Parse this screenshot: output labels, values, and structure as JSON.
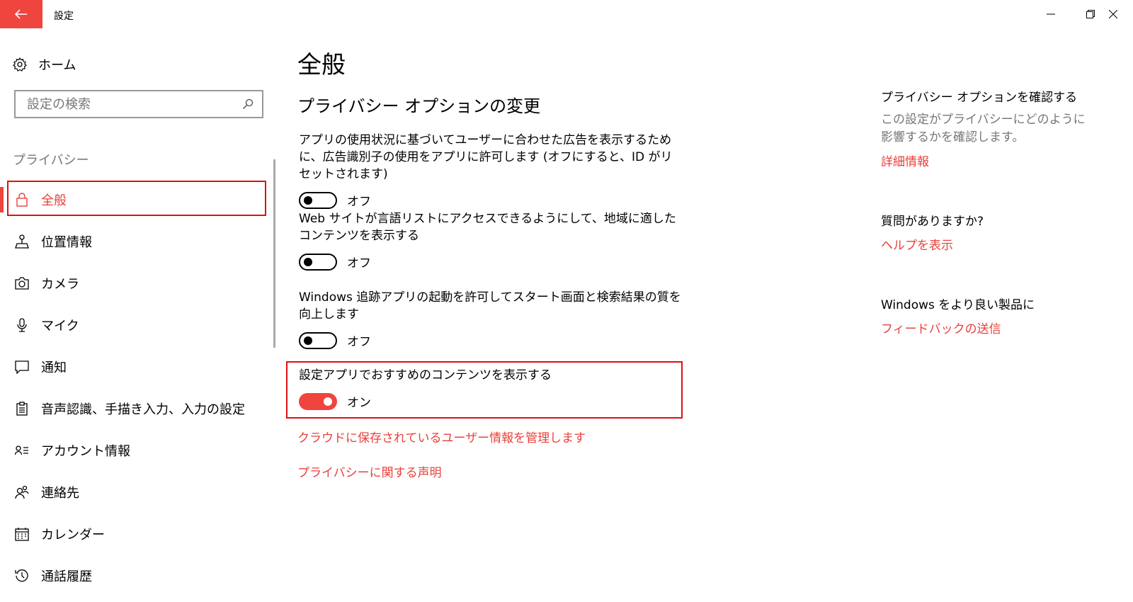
{
  "window": {
    "title": "設定",
    "accent_color": "#f0443e"
  },
  "sidebar": {
    "home_label": "ホーム",
    "search_placeholder": "設定の検索",
    "section_label": "プライバシー",
    "items": [
      {
        "label": "全般",
        "icon": "lock-icon",
        "active": true
      },
      {
        "label": "位置情報",
        "icon": "location-icon"
      },
      {
        "label": "カメラ",
        "icon": "camera-icon"
      },
      {
        "label": "マイク",
        "icon": "microphone-icon"
      },
      {
        "label": "通知",
        "icon": "notification-icon"
      },
      {
        "label": "音声認識、手描き入力、入力の設定",
        "icon": "clipboard-icon"
      },
      {
        "label": "アカウント情報",
        "icon": "account-info-icon"
      },
      {
        "label": "連絡先",
        "icon": "contacts-icon"
      },
      {
        "label": "カレンダー",
        "icon": "calendar-icon"
      },
      {
        "label": "通話履歴",
        "icon": "history-icon"
      }
    ]
  },
  "main": {
    "page_title": "全般",
    "section_title": "プライバシー オプションの変更",
    "settings": [
      {
        "desc": "アプリの使用状況に基づいてユーザーに合わせた広告を表示するために、広告識別子の使用をアプリに許可します (オフにすると、ID がリセットされます)",
        "state": "オフ"
      },
      {
        "desc": "Web サイトが言語リストにアクセスできるようにして、地域に適したコンテンツを表示する",
        "state": "オフ"
      },
      {
        "desc": "Windows 追跡アプリの起動を許可してスタート画面と検索結果の質を向上します",
        "state": "オフ"
      },
      {
        "desc": "設定アプリでおすすめのコンテンツを表示する",
        "state": "オン"
      }
    ],
    "links": {
      "cloud": "クラウドに保存されているユーザー情報を管理します",
      "privacy_statement": "プライバシーに関する声明"
    }
  },
  "right_panel": {
    "privacy_header": "プライバシー オプションを確認する",
    "privacy_desc": "この設定がプライバシーにどのように影響するかを確認します。",
    "privacy_link": "詳細情報",
    "question_header": "質問がありますか?",
    "help_link": "ヘルプを表示",
    "feedback_header": "Windows をより良い製品に",
    "feedback_link": "フィードバックの送信"
  }
}
